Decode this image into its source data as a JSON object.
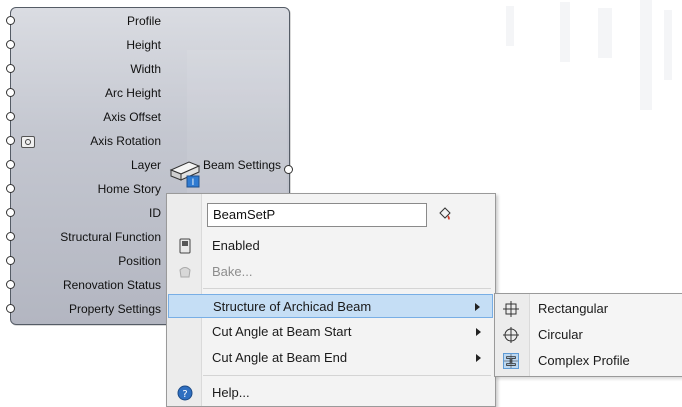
{
  "component": {
    "inputs": [
      {
        "label": "Profile"
      },
      {
        "label": "Height"
      },
      {
        "label": "Width"
      },
      {
        "label": "Arc Height"
      },
      {
        "label": "Axis Offset"
      },
      {
        "label": "Axis Rotation"
      },
      {
        "label": "Layer"
      },
      {
        "label": "Home Story"
      },
      {
        "label": "ID"
      },
      {
        "label": "Structural Function"
      },
      {
        "label": "Position"
      },
      {
        "label": "Renovation Status"
      },
      {
        "label": "Property Settings"
      }
    ],
    "output_label": "Beam Settings",
    "icon": "beam-settings-icon"
  },
  "context_menu": {
    "name_value": "BeamSetP",
    "items": {
      "enabled": "Enabled",
      "bake": "Bake...",
      "structure": "Structure of Archicad Beam",
      "cut_start": "Cut Angle at Beam Start",
      "cut_end": "Cut Angle at Beam End",
      "help": "Help..."
    },
    "highlight_color": "#c5def5"
  },
  "submenu": {
    "items": [
      {
        "label": "Rectangular",
        "icon": "rectangular-icon"
      },
      {
        "label": "Circular",
        "icon": "circular-icon"
      },
      {
        "label": "Complex Profile",
        "icon": "complex-profile-icon",
        "selected": true
      }
    ]
  }
}
